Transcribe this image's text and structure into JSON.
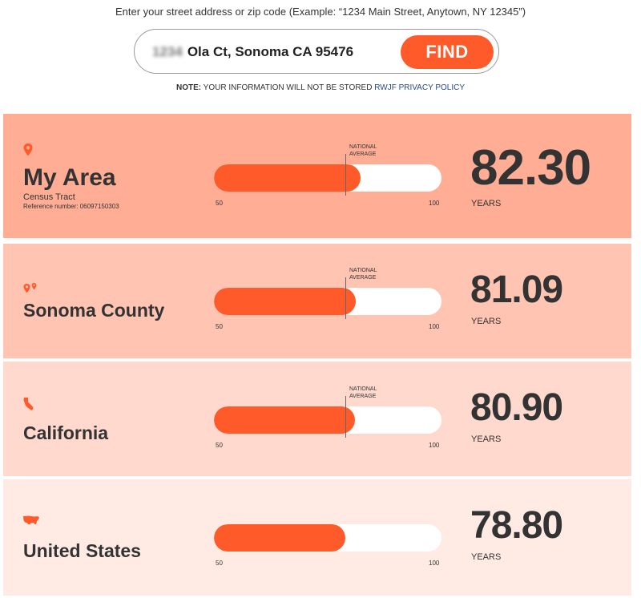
{
  "search": {
    "instructions": "Enter your street address or zip code (Example: “1234 Main Street, Anytown, NY 12345”)",
    "address_blurred": "1234",
    "address_value": "Ola Ct, Sonoma CA 95476",
    "find_label": "FIND"
  },
  "note": {
    "prefix": "NOTE:",
    "text": " YOUR INFORMATION WILL NOT BE STORED ",
    "link": "RWJF PRIVACY POLICY"
  },
  "chart_common": {
    "axis_min_label": "50",
    "axis_max_label": "100",
    "axis_min": 50,
    "axis_max": 100,
    "national_average_label_line1": "NATIONAL",
    "national_average_label_line2": "AVERAGE",
    "national_average": 78.8
  },
  "panels": [
    {
      "name": "My Area",
      "icon": "map-pin-icon",
      "subtitle": "Census Tract",
      "reference": "Reference number: 06097150303",
      "value": "82.30",
      "numeric": 82.3,
      "unit": "YEARS",
      "bg": "#ffad94"
    },
    {
      "name": "Sonoma County",
      "icon": "map-pins-icon",
      "value": "81.09",
      "numeric": 81.09,
      "unit": "YEARS",
      "bg": "#ffc4b2"
    },
    {
      "name": "California",
      "icon": "california-icon",
      "value": "80.90",
      "numeric": 80.9,
      "unit": "YEARS",
      "bg": "#ffd9cd"
    },
    {
      "name": "United States",
      "icon": "usa-map-icon",
      "value": "78.80",
      "numeric": 78.8,
      "unit": "YEARS",
      "bg": "#ffebe4"
    }
  ],
  "colors": {
    "accent": "#ff5a2a",
    "link": "#2a4a8a"
  }
}
